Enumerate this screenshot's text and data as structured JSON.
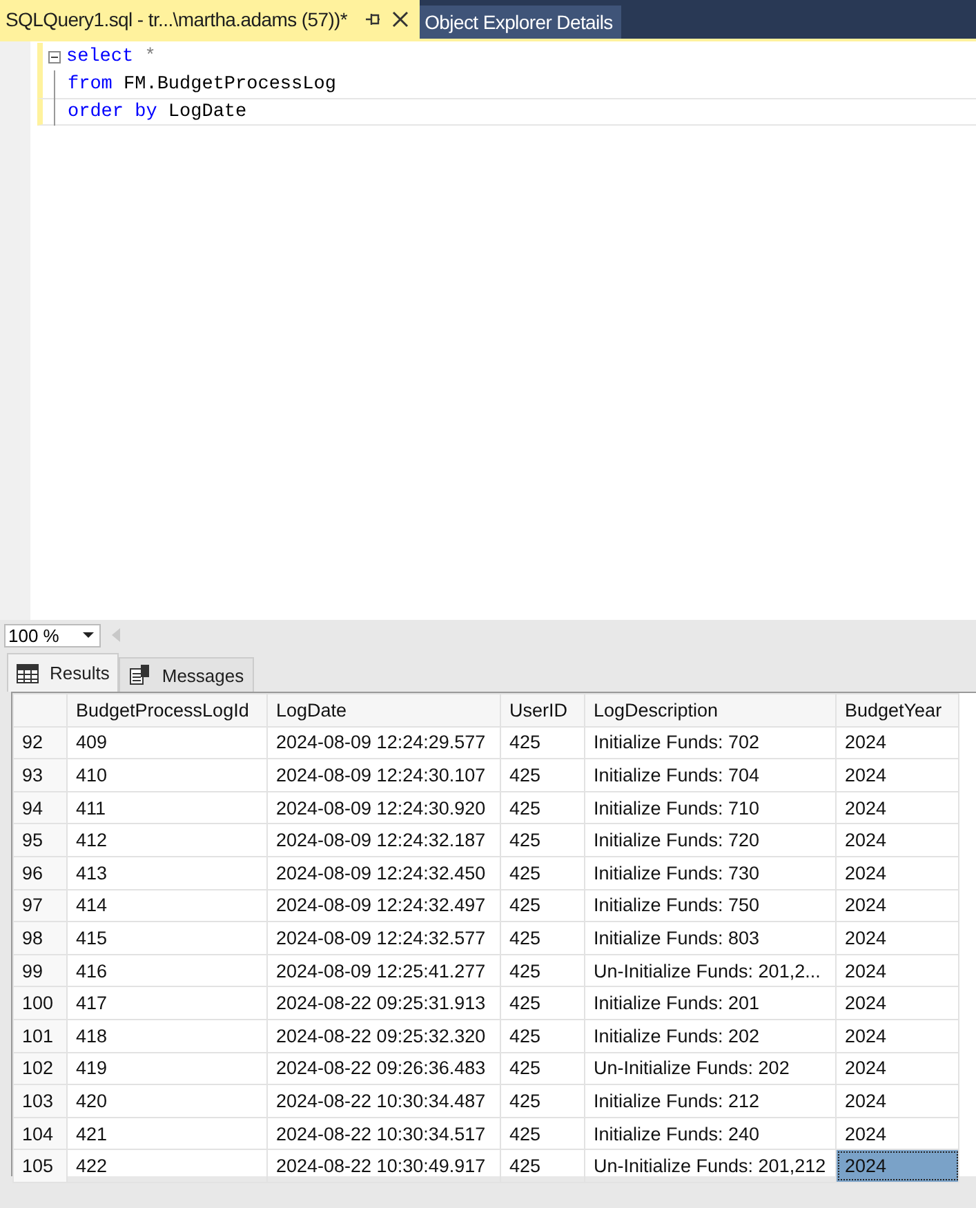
{
  "doc_tabs": [
    {
      "label": "SQLQuery1.sql - tr...\\martha.adams (57))*",
      "selected": true,
      "pinnable": true
    },
    {
      "label": "Object Explorer Details",
      "selected": false,
      "pinnable": false
    }
  ],
  "editor": {
    "lines": [
      [
        {
          "kind": "keyword",
          "text": "select"
        },
        {
          "kind": "operator",
          "text": "*"
        }
      ],
      [
        {
          "kind": "keyword",
          "text": "from"
        },
        {
          "kind": "plain",
          "text": "FM.BudgetProcessLog"
        }
      ],
      [
        {
          "kind": "keyword",
          "text": "order by"
        },
        {
          "kind": "plain",
          "text": "LogDate"
        }
      ]
    ]
  },
  "zoom": {
    "value": "100 %"
  },
  "result_tabs": [
    {
      "label": "Results",
      "kind": "grid",
      "selected": true
    },
    {
      "label": "Messages",
      "kind": "messages",
      "selected": false
    }
  ],
  "grid": {
    "columns": [
      "BudgetProcessLogId",
      "LogDate",
      "UserID",
      "LogDescription",
      "BudgetYear"
    ],
    "rows": [
      {
        "number": "92",
        "cells": [
          {
            "text": "409",
            "selected": false
          },
          {
            "text": "2024-08-09 12:24:29.577",
            "selected": false
          },
          {
            "text": "425",
            "selected": false
          },
          {
            "text": "Initialize Funds: 702",
            "selected": false
          },
          {
            "text": "2024",
            "selected": false
          }
        ]
      },
      {
        "number": "93",
        "cells": [
          {
            "text": "410",
            "selected": false
          },
          {
            "text": "2024-08-09 12:24:30.107",
            "selected": false
          },
          {
            "text": "425",
            "selected": false
          },
          {
            "text": "Initialize Funds: 704",
            "selected": false
          },
          {
            "text": "2024",
            "selected": false
          }
        ]
      },
      {
        "number": "94",
        "cells": [
          {
            "text": "411",
            "selected": false
          },
          {
            "text": "2024-08-09 12:24:30.920",
            "selected": false
          },
          {
            "text": "425",
            "selected": false
          },
          {
            "text": "Initialize Funds: 710",
            "selected": false
          },
          {
            "text": "2024",
            "selected": false
          }
        ]
      },
      {
        "number": "95",
        "cells": [
          {
            "text": "412",
            "selected": false
          },
          {
            "text": "2024-08-09 12:24:32.187",
            "selected": false
          },
          {
            "text": "425",
            "selected": false
          },
          {
            "text": "Initialize Funds: 720",
            "selected": false
          },
          {
            "text": "2024",
            "selected": false
          }
        ]
      },
      {
        "number": "96",
        "cells": [
          {
            "text": "413",
            "selected": false
          },
          {
            "text": "2024-08-09 12:24:32.450",
            "selected": false
          },
          {
            "text": "425",
            "selected": false
          },
          {
            "text": "Initialize Funds: 730",
            "selected": false
          },
          {
            "text": "2024",
            "selected": false
          }
        ]
      },
      {
        "number": "97",
        "cells": [
          {
            "text": "414",
            "selected": false
          },
          {
            "text": "2024-08-09 12:24:32.497",
            "selected": false
          },
          {
            "text": "425",
            "selected": false
          },
          {
            "text": "Initialize Funds: 750",
            "selected": false
          },
          {
            "text": "2024",
            "selected": false
          }
        ]
      },
      {
        "number": "98",
        "cells": [
          {
            "text": "415",
            "selected": false
          },
          {
            "text": "2024-08-09 12:24:32.577",
            "selected": false
          },
          {
            "text": "425",
            "selected": false
          },
          {
            "text": "Initialize Funds: 803",
            "selected": false
          },
          {
            "text": "2024",
            "selected": false
          }
        ]
      },
      {
        "number": "99",
        "cells": [
          {
            "text": "416",
            "selected": false
          },
          {
            "text": "2024-08-09 12:25:41.277",
            "selected": false
          },
          {
            "text": "425",
            "selected": false
          },
          {
            "text": "Un-Initialize Funds: 201,2...",
            "selected": false
          },
          {
            "text": "2024",
            "selected": false
          }
        ]
      },
      {
        "number": "100",
        "cells": [
          {
            "text": "417",
            "selected": false
          },
          {
            "text": "2024-08-22 09:25:31.913",
            "selected": false
          },
          {
            "text": "425",
            "selected": false
          },
          {
            "text": "Initialize Funds: 201",
            "selected": false
          },
          {
            "text": "2024",
            "selected": false
          }
        ]
      },
      {
        "number": "101",
        "cells": [
          {
            "text": "418",
            "selected": false
          },
          {
            "text": "2024-08-22 09:25:32.320",
            "selected": false
          },
          {
            "text": "425",
            "selected": false
          },
          {
            "text": "Initialize Funds: 202",
            "selected": false
          },
          {
            "text": "2024",
            "selected": false
          }
        ]
      },
      {
        "number": "102",
        "cells": [
          {
            "text": "419",
            "selected": false
          },
          {
            "text": "2024-08-22 09:26:36.483",
            "selected": false
          },
          {
            "text": "425",
            "selected": false
          },
          {
            "text": "Un-Initialize Funds: 202",
            "selected": false
          },
          {
            "text": "2024",
            "selected": false
          }
        ]
      },
      {
        "number": "103",
        "cells": [
          {
            "text": "420",
            "selected": false
          },
          {
            "text": "2024-08-22 10:30:34.487",
            "selected": false
          },
          {
            "text": "425",
            "selected": false
          },
          {
            "text": "Initialize Funds: 212",
            "selected": false
          },
          {
            "text": "2024",
            "selected": false
          }
        ]
      },
      {
        "number": "104",
        "cells": [
          {
            "text": "421",
            "selected": false
          },
          {
            "text": "2024-08-22 10:30:34.517",
            "selected": false
          },
          {
            "text": "425",
            "selected": false
          },
          {
            "text": "Initialize Funds: 240",
            "selected": false
          },
          {
            "text": "2024",
            "selected": false
          }
        ]
      },
      {
        "number": "105",
        "cells": [
          {
            "text": "422",
            "selected": false
          },
          {
            "text": "2024-08-22 10:30:49.917",
            "selected": false
          },
          {
            "text": "425",
            "selected": false
          },
          {
            "text": "Un-Initialize Funds: 201,212",
            "selected": false
          },
          {
            "text": "2024",
            "selected": true
          }
        ]
      }
    ]
  }
}
